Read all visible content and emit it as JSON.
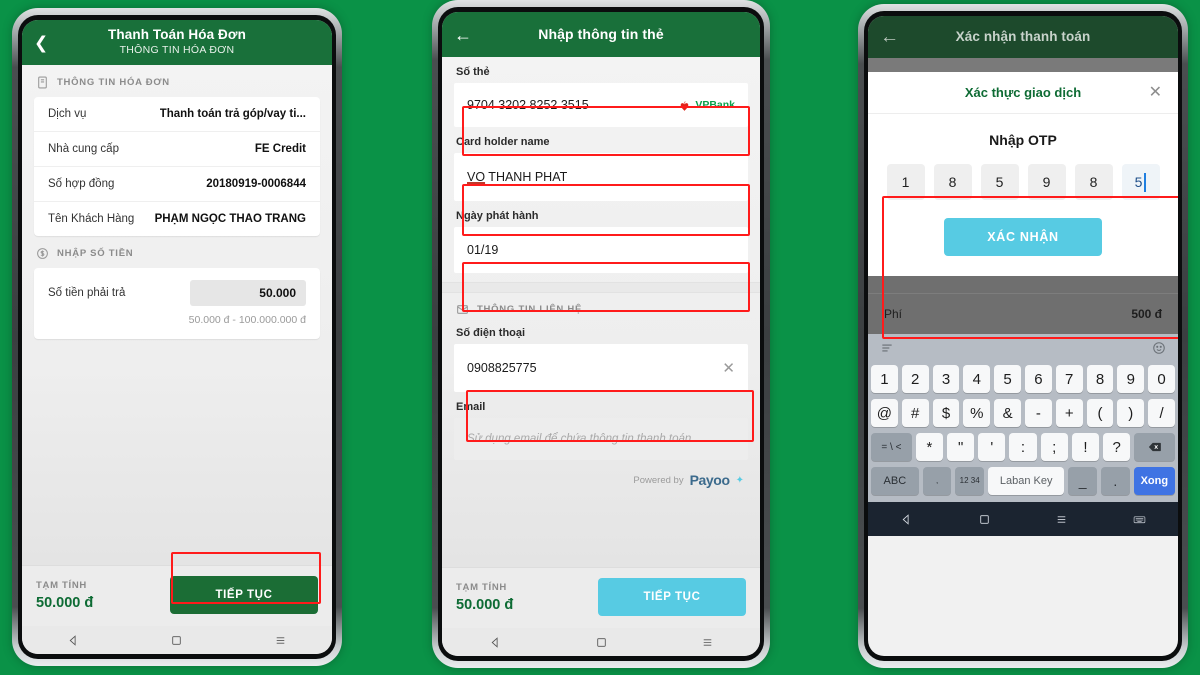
{
  "background_color": "#0a9247",
  "accent": {
    "green": "#19703a",
    "cyan": "#57cbe3",
    "highlight_red": "#ff1b1b",
    "money_green": "#0d6b34"
  },
  "phone1": {
    "header": {
      "title": "Thanh Toán Hóa Đơn",
      "subtitle": "THÔNG TIN HÓA ĐƠN",
      "back_icon": "chevron-left-icon"
    },
    "section_invoice": {
      "icon": "document-icon",
      "label": "THÔNG TIN HÓA ĐƠN"
    },
    "invoice_rows": [
      {
        "label": "Dịch vụ",
        "value": "Thanh toán trả góp/vay ti..."
      },
      {
        "label": "Nhà cung cấp",
        "value": "FE Credit"
      },
      {
        "label": "Số hợp đồng",
        "value": "20180919-0006844"
      },
      {
        "label": "Tên Khách Hàng",
        "value": "PHẠM NGỌC THẢO TRANG"
      }
    ],
    "section_amount": {
      "icon": "dollar-circle-icon",
      "label": "NHẬP SỐ TIỀN"
    },
    "amount": {
      "label": "Số tiền phải trả",
      "value": "50.000",
      "hint": "50.000 đ - 100.000.000 đ"
    },
    "footer": {
      "label": "TẠM TÍNH",
      "amount": "50.000 đ",
      "cta": "TIẾP TỤC"
    },
    "navbar": [
      "back-triangle-icon",
      "home-square-icon",
      "recents-lines-icon"
    ]
  },
  "phone2": {
    "header": {
      "title": "Nhập thông tin thẻ",
      "back_icon": "arrow-left-icon"
    },
    "card_number": {
      "label": "Số thẻ",
      "value": "9704 3202 8252 3515",
      "bank": "VPBank",
      "bank_icon": "vpbank-flower-icon"
    },
    "card_holder": {
      "label": "Card holder name",
      "value_underlined": "VO",
      "value_rest": " THANH PHAT"
    },
    "issue_date": {
      "label": "Ngày phát hành",
      "value": "01/19"
    },
    "section_contact": {
      "icon": "mail-icon",
      "label": "THÔNG TIN LIÊN HỆ"
    },
    "phone_field": {
      "label": "Số điện thoại",
      "value": "0908825775",
      "clear_icon": "close-x-icon"
    },
    "email_field": {
      "label": "Email",
      "placeholder": "Sử dụng email để chứa thông tin thanh toán"
    },
    "powered": {
      "label": "Powered by",
      "brand": "Payoo"
    },
    "footer": {
      "label": "TẠM TÍNH",
      "amount": "50.000 đ",
      "cta": "TIẾP TỤC"
    },
    "navbar": [
      "back-triangle-icon",
      "home-square-icon",
      "recents-lines-icon"
    ]
  },
  "phone3": {
    "header": {
      "title": "Xác nhận thanh toán",
      "back_icon": "arrow-left-icon"
    },
    "dialog": {
      "title": "Xác thực giao dịch",
      "close_icon": "close-x-icon",
      "otp_title": "Nhập OTP",
      "otp_digits": [
        "1",
        "8",
        "5",
        "9",
        "8",
        "5"
      ],
      "confirm": "XÁC NHẬN"
    },
    "behind_row": {
      "label": "Phí",
      "value": "500 đ"
    },
    "keyboard": {
      "menu_icon": "hamburger-icon",
      "emoji_icon": "smiley-icon",
      "row1": [
        "1",
        "2",
        "3",
        "4",
        "5",
        "6",
        "7",
        "8",
        "9",
        "0"
      ],
      "row2": [
        "@",
        "#",
        "$",
        "%",
        "&",
        "-",
        "+",
        "(",
        ")",
        "/"
      ],
      "row3": [
        "= \\ <",
        "*",
        "\"",
        "'",
        ":",
        ";",
        "!",
        "?",
        "backspace-icon"
      ],
      "row4": [
        "ABC",
        ", ",
        "12 34",
        "Laban Key",
        "_",
        ".",
        "Xong"
      ]
    },
    "navbar": [
      "back-triangle-icon",
      "home-square-icon",
      "recents-lines-icon",
      "keyboard-icon"
    ]
  }
}
